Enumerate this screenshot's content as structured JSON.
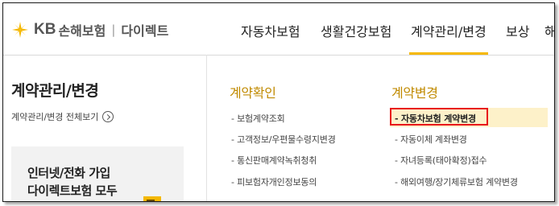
{
  "brand": {
    "kb": "KB",
    "name": "손해보험",
    "sep": "|",
    "sub": "다이렉트"
  },
  "gnb": [
    {
      "label": "자동차보험",
      "active": false
    },
    {
      "label": "생활건강보험",
      "active": false
    },
    {
      "label": "계약관리/변경",
      "active": true
    },
    {
      "label": "보상",
      "active": false
    },
    {
      "label": "해",
      "active": false
    }
  ],
  "left": {
    "title": "계약관리/변경",
    "all_link": "계약관리/변경 전체보기",
    "promo_line1": "인터넷/전화 가입",
    "promo_line2": "다이렉트보험 모두"
  },
  "menu": {
    "col1": {
      "title": "계약확인",
      "items": [
        "- 보험계약조회",
        "- 고객정보/우편물수령지변경",
        "- 통신판매계약녹취청취",
        "- 피보험자개인정보동의"
      ]
    },
    "col2": {
      "title": "계약변경",
      "items": [
        "- 자동차보험 계약변경",
        "- 자동이체 계좌변경",
        "- 자녀등록(태아확정)접수",
        "- 해외여행/장기체류보험 계약변경"
      ]
    }
  },
  "colors": {
    "accent": "#f5b800",
    "menu_title": "#c08a00",
    "highlight_border": "#e8141b",
    "highlight_bg": "#fdf1c9"
  }
}
